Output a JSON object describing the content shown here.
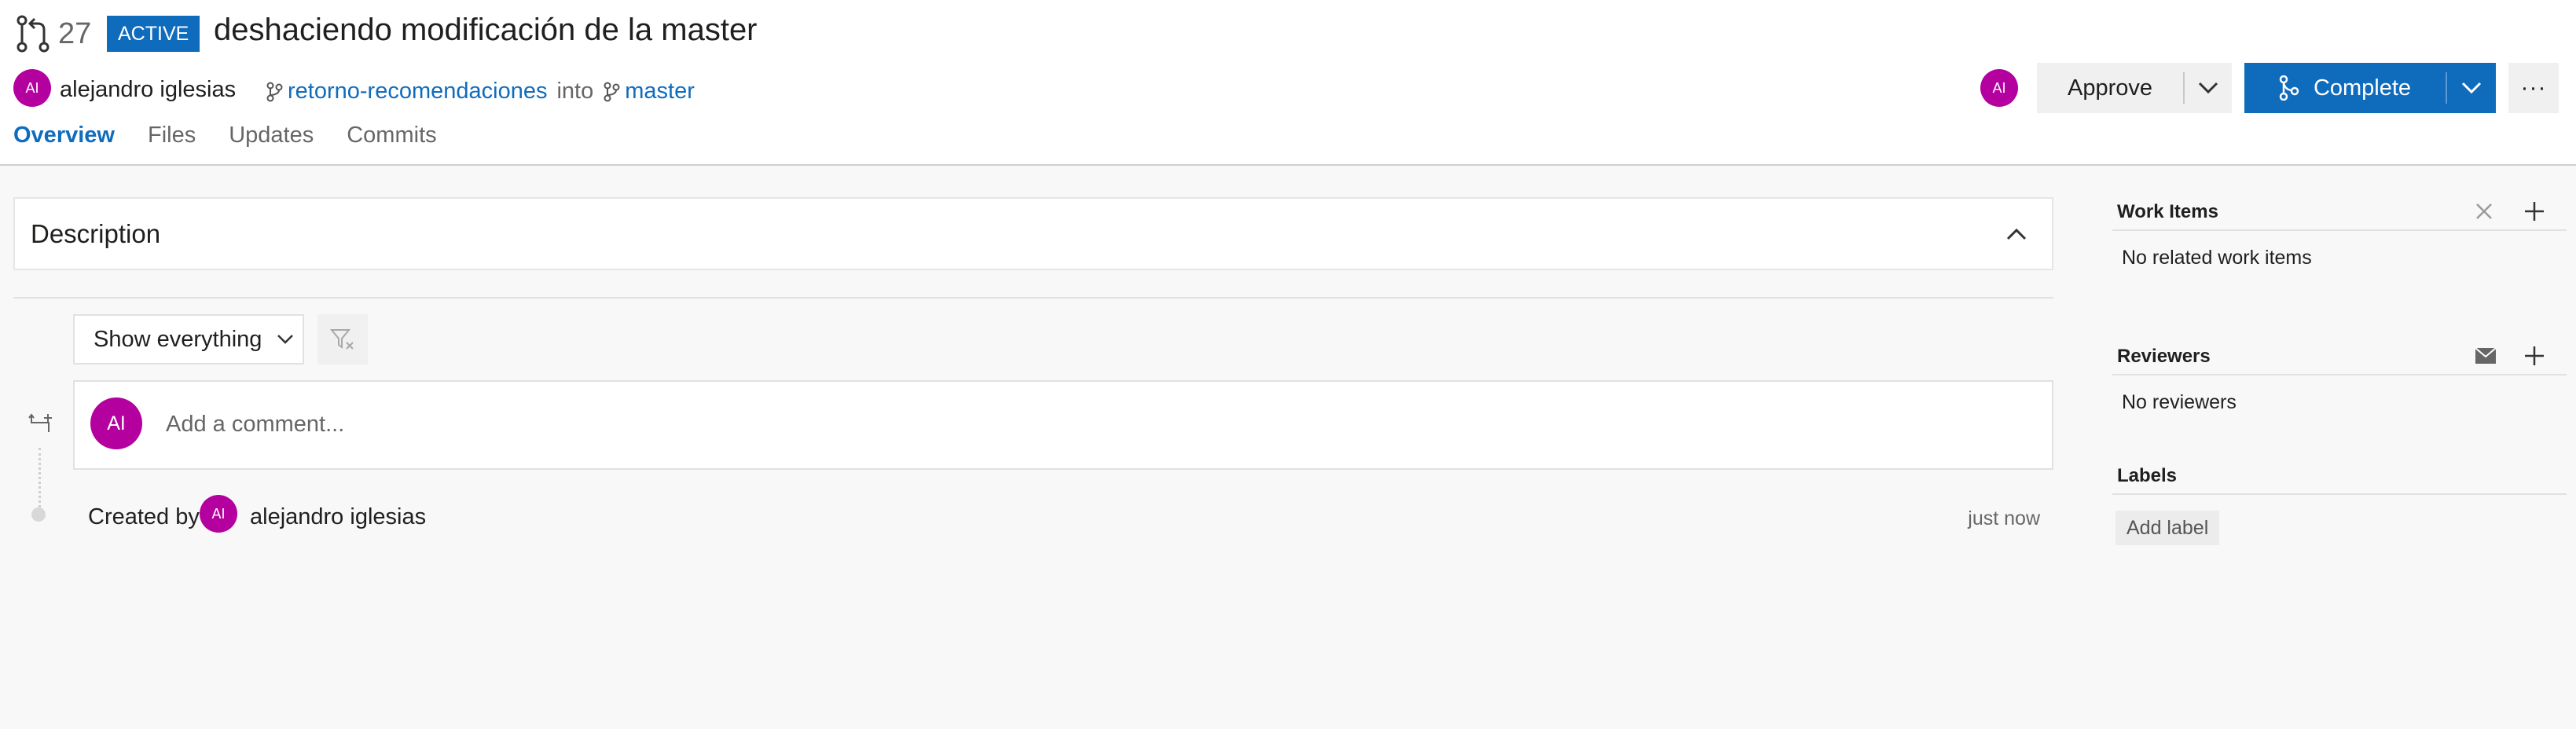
{
  "header": {
    "pr_number": "27",
    "status": "ACTIVE",
    "title": "deshaciendo modificación de la master",
    "author": {
      "initials": "AI",
      "name": "alejandro iglesias"
    },
    "source_branch": "retorno-recomendaciones",
    "into_text": "into",
    "target_branch": "master",
    "reviewer_avatar": "AI",
    "tabs": [
      {
        "label": "Overview",
        "active": true
      },
      {
        "label": "Files",
        "active": false
      },
      {
        "label": "Updates",
        "active": false
      },
      {
        "label": "Commits",
        "active": false
      }
    ],
    "actions": {
      "approve_label": "Approve",
      "complete_label": "Complete",
      "more_label": "···"
    }
  },
  "main": {
    "description_title": "Description",
    "filter_label": "Show everything",
    "comment": {
      "avatar": "AI",
      "placeholder": "Add a comment..."
    },
    "created": {
      "prefix": "Created by",
      "avatar": "AI",
      "author": "alejandro iglesias",
      "time": "just now"
    }
  },
  "sidebar": {
    "work_items": {
      "title": "Work Items",
      "empty_text": "No related work items"
    },
    "reviewers": {
      "title": "Reviewers",
      "empty_text": "No reviewers"
    },
    "labels": {
      "title": "Labels",
      "add_label": "Add label"
    }
  },
  "colors": {
    "accent": "#0f6cbd",
    "avatar": "#b4009e",
    "page_background": "#f8f8f8"
  }
}
